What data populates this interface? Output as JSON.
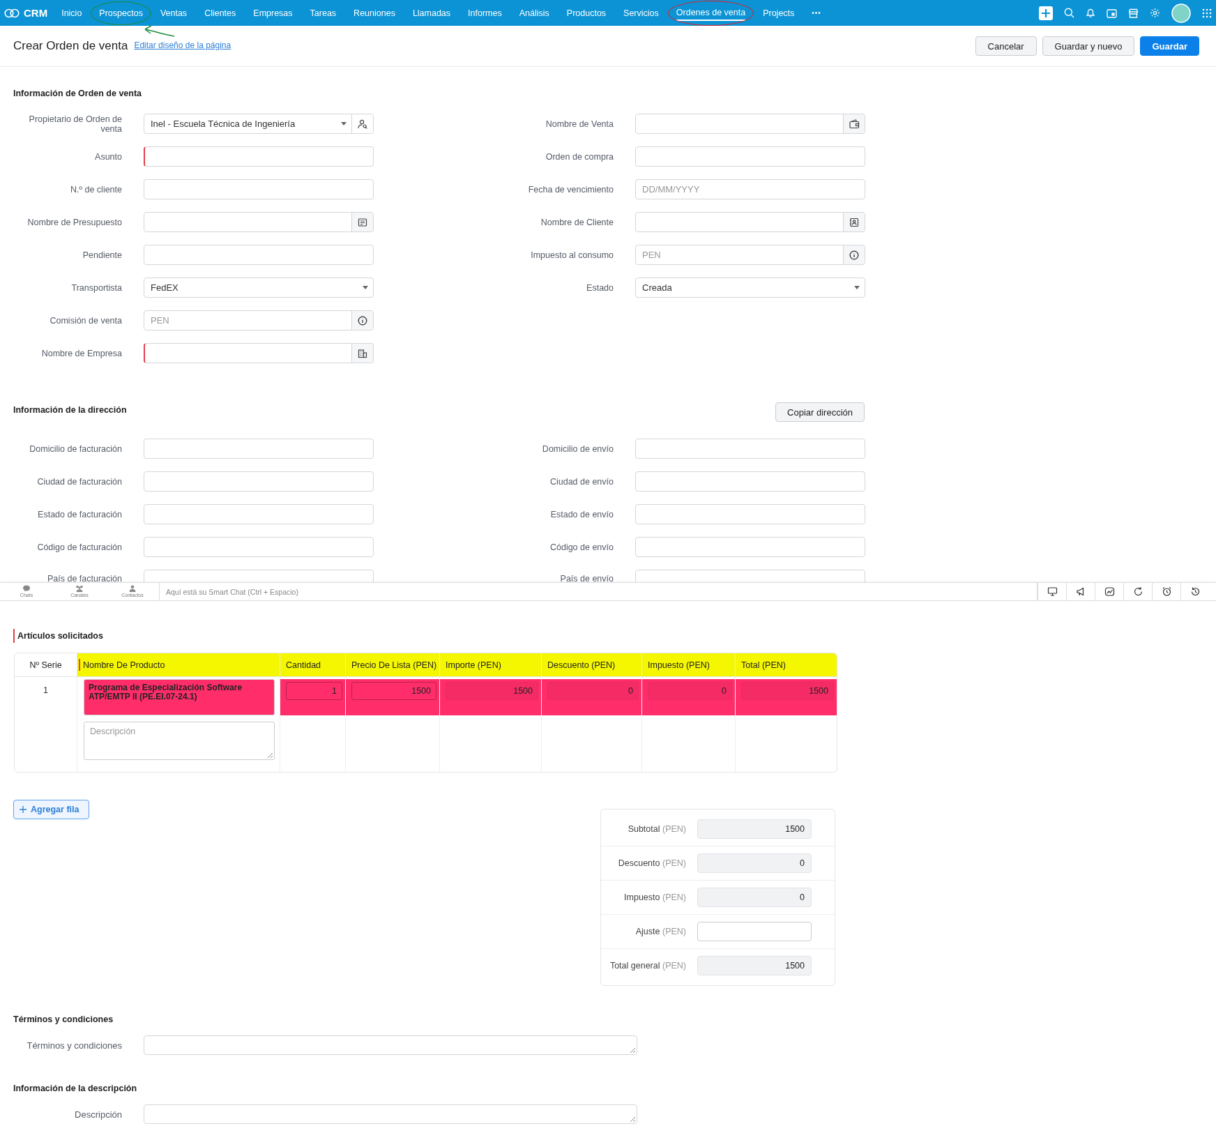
{
  "topbar": {
    "brand": "CRM",
    "nav": [
      {
        "label": "Inicio",
        "selected": false
      },
      {
        "label": "Prospectos",
        "selected": false,
        "annotation": {
          "color": "#1f8a3a",
          "arrow": true
        }
      },
      {
        "label": "Ventas",
        "selected": false
      },
      {
        "label": "Clientes",
        "selected": false
      },
      {
        "label": "Empresas",
        "selected": false
      },
      {
        "label": "Tareas",
        "selected": false
      },
      {
        "label": "Reuniones",
        "selected": false
      },
      {
        "label": "Llamadas",
        "selected": false
      },
      {
        "label": "Informes",
        "selected": false
      },
      {
        "label": "Análisis",
        "selected": false
      },
      {
        "label": "Productos",
        "selected": false
      },
      {
        "label": "Servicios",
        "selected": false
      },
      {
        "label": "Ordenes de venta",
        "selected": true,
        "annotation": {
          "color": "#e0202a",
          "arrow": false
        }
      },
      {
        "label": "Projects",
        "selected": false
      }
    ],
    "more": "•••"
  },
  "header": {
    "title": "Crear Orden de venta",
    "link": "Editar diseño de la página",
    "buttons": [
      {
        "label": "Cancelar",
        "kind": "secondary"
      },
      {
        "label": "Guardar y nuevo",
        "kind": "secondary"
      },
      {
        "label": "Guardar",
        "kind": "primary"
      }
    ]
  },
  "order_info": {
    "title": "Información de Orden de venta",
    "left": [
      {
        "label": "Propietario de Orden de venta",
        "kind": "owner",
        "value": "Inel - Escuela Técnica de Ingeniería",
        "required": false
      },
      {
        "label": "Asunto",
        "kind": "text",
        "required": true
      },
      {
        "label": "N.º de cliente",
        "kind": "text",
        "required": false
      },
      {
        "label": "Nombre de Presupuesto",
        "kind": "quote",
        "required": false
      },
      {
        "label": "Pendiente",
        "kind": "text",
        "required": false
      },
      {
        "label": "Transportista",
        "kind": "select",
        "value": "FedEX",
        "required": false
      },
      {
        "label": "Comisión de venta",
        "kind": "currency",
        "placeholder": "PEN",
        "required": false
      },
      {
        "label": "Nombre de Empresa",
        "kind": "company",
        "required": true
      }
    ],
    "right": [
      {
        "label": "Nombre de Venta",
        "kind": "deal",
        "required": false
      },
      {
        "label": "Orden de compra",
        "kind": "text",
        "required": false
      },
      {
        "label": "Fecha de vencimiento",
        "kind": "text",
        "placeholder": "DD/MM/YYYY",
        "required": false
      },
      {
        "label": "Nombre de Cliente",
        "kind": "contact",
        "required": false
      },
      {
        "label": "Impuesto al consumo",
        "kind": "currency",
        "placeholder": "PEN",
        "required": false
      },
      {
        "label": "Estado",
        "kind": "select",
        "value": "Creada",
        "required": false
      }
    ]
  },
  "address_info": {
    "title": "Información de la dirección",
    "copy_button": "Copiar dirección",
    "left": [
      {
        "label": "Domicilio de facturación"
      },
      {
        "label": "Ciudad de facturación"
      },
      {
        "label": "Estado de facturación"
      },
      {
        "label": "Código de facturación"
      },
      {
        "label": "País de facturación"
      }
    ],
    "right": [
      {
        "label": "Domicilio de envío"
      },
      {
        "label": "Ciudad de envío"
      },
      {
        "label": "Estado de envío"
      },
      {
        "label": "Código de envío"
      },
      {
        "label": "País de envío"
      }
    ]
  },
  "chat_bar": {
    "tabs": [
      "Chats",
      "Canales",
      "Contactos"
    ],
    "placeholder": "Aquí está su Smart Chat (Ctrl + Espacio)"
  },
  "items": {
    "title": "Artículos solicitados",
    "header": {
      "color": "#f5f700"
    },
    "columns": [
      "Nº Serie",
      "Nombre De Producto",
      "Cantidad",
      "Precio De Lista (PEN)",
      "Importe (PEN)",
      "Descuento (PEN)",
      "Impuesto (PEN)",
      "Total (PEN)"
    ],
    "rows": [
      {
        "cells": [
          "1",
          "Programa de Especialización Software ATP/EMTP II (PE.EI.07-24.1)",
          "1",
          "1500",
          "1500",
          "0",
          "0",
          "1500"
        ],
        "description_placeholder": "Descripción",
        "color": "#ff2d6a"
      }
    ],
    "add_row": "Agregar fila"
  },
  "totals": [
    {
      "label": "Subtotal",
      "unit": "(PEN)",
      "value": "1500",
      "kind": "readonly"
    },
    {
      "label": "Descuento",
      "unit": "(PEN)",
      "value": "0",
      "kind": "readonly"
    },
    {
      "label": "Impuesto",
      "unit": "(PEN)",
      "value": "0",
      "kind": "readonly"
    },
    {
      "label": "Ajuste",
      "unit": "(PEN)",
      "kind": "input"
    },
    {
      "label": "Total general",
      "unit": "(PEN)",
      "value": "1500",
      "kind": "readonly"
    }
  ],
  "terms": {
    "title": "Términos y condiciones",
    "label": "Términos y condiciones"
  },
  "description": {
    "title": "Información de la descripción",
    "label": "Descripción"
  }
}
